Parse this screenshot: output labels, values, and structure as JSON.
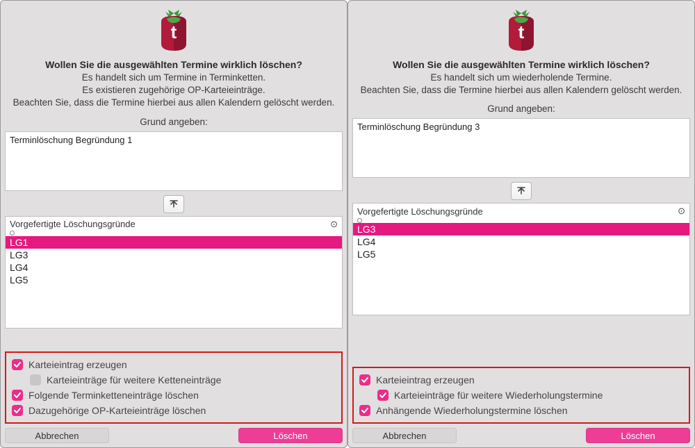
{
  "dialogs": [
    {
      "headline": "Wollen Sie die ausgewählten Termine wirklich löschen?",
      "sublines": [
        "Es handelt sich um Termine in Terminketten.",
        "Es existieren zugehörige OP-Karteieinträge.",
        "Beachten Sie, dass die Termine hierbei aus allen Kalendern gelöscht werden."
      ],
      "prompt": "Grund angeben:",
      "reason_text": "Terminlöschung Begründung 1",
      "reasons_label": "Vorgefertigte Löschungsgründe",
      "reasons": [
        "LG1",
        "LG3",
        "LG4",
        "LG5"
      ],
      "selected_index": 0,
      "checkboxes": [
        {
          "label": "Karteieintrag erzeugen",
          "checked": true,
          "indent": false
        },
        {
          "label": "Karteieinträge für weitere Ketteneinträge",
          "checked": false,
          "indent": true
        },
        {
          "label": "Folgende Terminketteneinträge löschen",
          "checked": true,
          "indent": false
        },
        {
          "label": "Dazugehörige OP-Karteieinträge löschen",
          "checked": true,
          "indent": false
        }
      ],
      "cancel_label": "Abbrechen",
      "delete_label": "Löschen"
    },
    {
      "headline": "Wollen Sie die ausgewählten Termine wirklich löschen?",
      "sublines": [
        "Es handelt sich um wiederholende Termine.",
        "Beachten Sie, dass die Termine hierbei aus allen Kalendern gelöscht werden."
      ],
      "prompt": "Grund angeben:",
      "reason_text": "Terminlöschung Begründung 3",
      "reasons_label": "Vorgefertigte Löschungsgründe",
      "reasons": [
        "LG3",
        "LG4",
        "LG5"
      ],
      "selected_index": 0,
      "checkboxes": [
        {
          "label": "Karteieintrag erzeugen",
          "checked": true,
          "indent": false
        },
        {
          "label": "Karteieinträge für weitere Wiederholungstermine",
          "checked": true,
          "indent": true
        },
        {
          "label": "Anhängende Wiederholungstermine löschen",
          "checked": true,
          "indent": false
        }
      ],
      "cancel_label": "Abbrechen",
      "delete_label": "Löschen"
    }
  ],
  "colors": {
    "accent": "#ec2c8b",
    "highlight_border": "#d11a1a"
  }
}
